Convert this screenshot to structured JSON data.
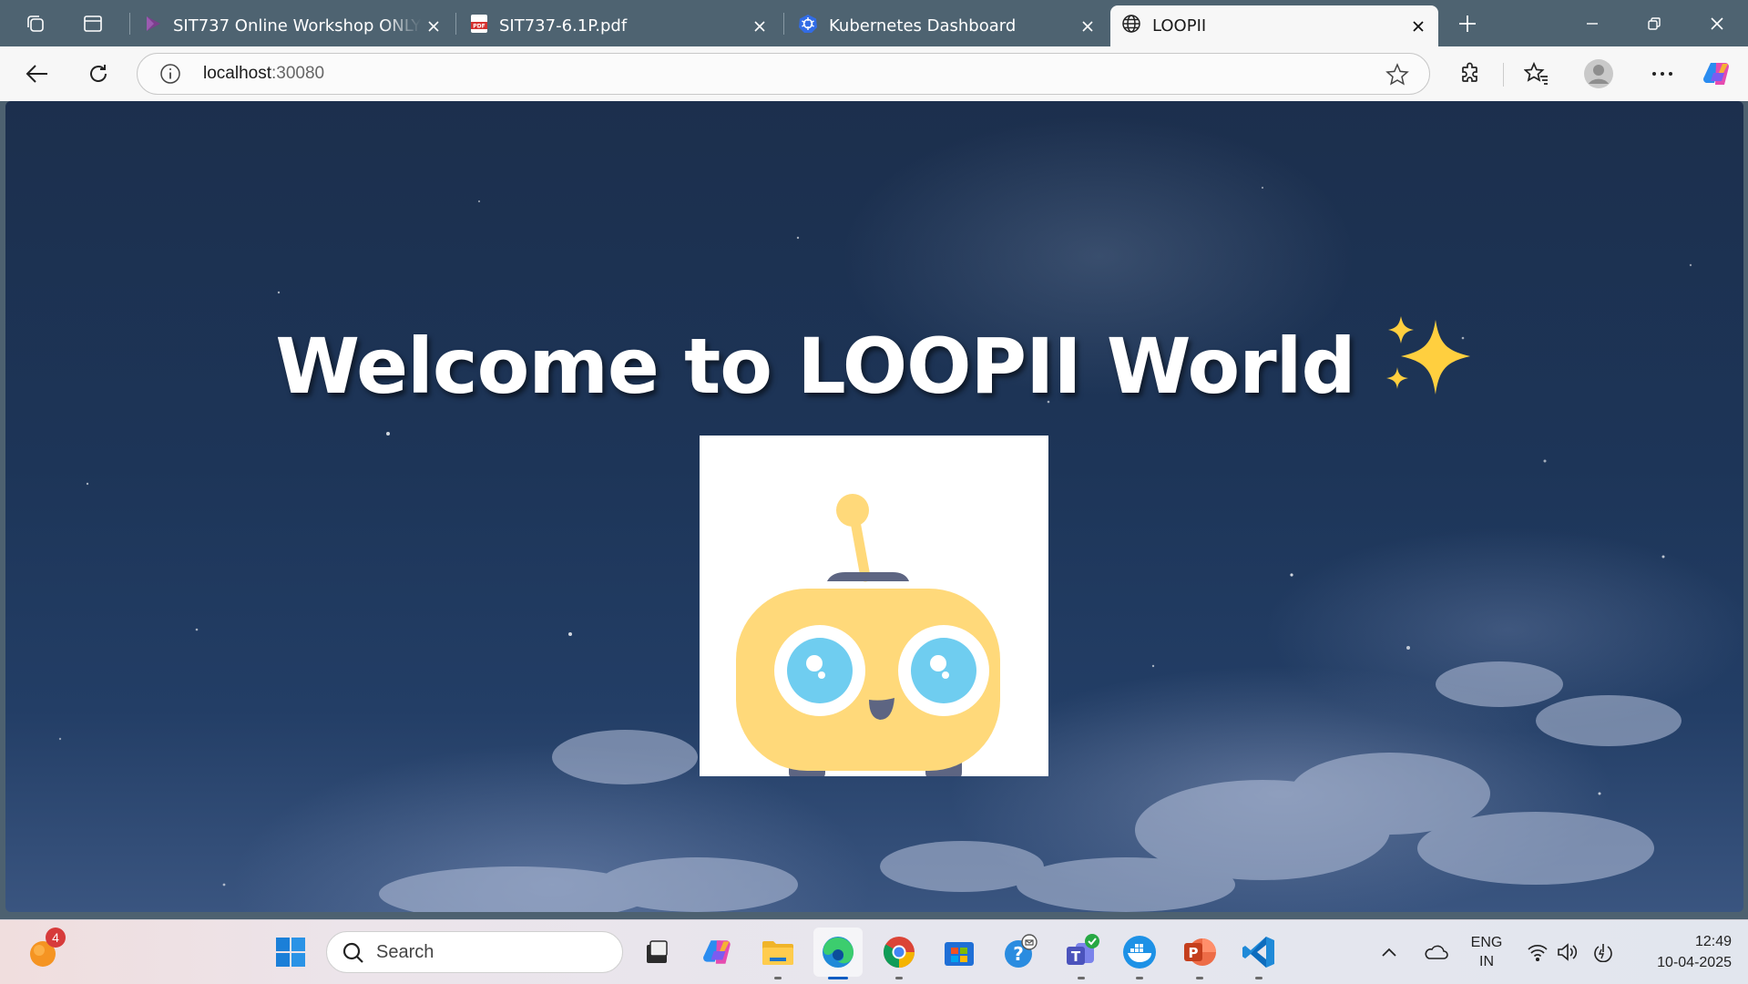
{
  "browser": {
    "tabs": [
      {
        "title": "SIT737 Online Workshop ONLY fo",
        "icon": "video-icon",
        "active": false
      },
      {
        "title": "SIT737-6.1P.pdf",
        "icon": "pdf-icon",
        "active": false
      },
      {
        "title": "Kubernetes Dashboard",
        "icon": "kubernetes-icon",
        "active": false
      },
      {
        "title": "LOOPII",
        "icon": "globe-icon",
        "active": true
      }
    ],
    "address": {
      "host": "localhost",
      "port": ":30080"
    }
  },
  "page": {
    "headline": "Welcome to LOOPII World",
    "sparkle": "✨",
    "mascot": "robot-mascot"
  },
  "taskbar": {
    "notification_badge": "4",
    "search_label": "Search",
    "language": {
      "line1": "ENG",
      "line2": "IN"
    },
    "clock": {
      "time": "12:49",
      "date": "10-04-2025"
    }
  },
  "colors": {
    "titlebar": "#4e6371",
    "toolbar": "#f7f7f7",
    "sky_top": "#1c2f4d",
    "mascot_yellow": "#ffd97a",
    "eye_blue": "#6fcdf0"
  }
}
